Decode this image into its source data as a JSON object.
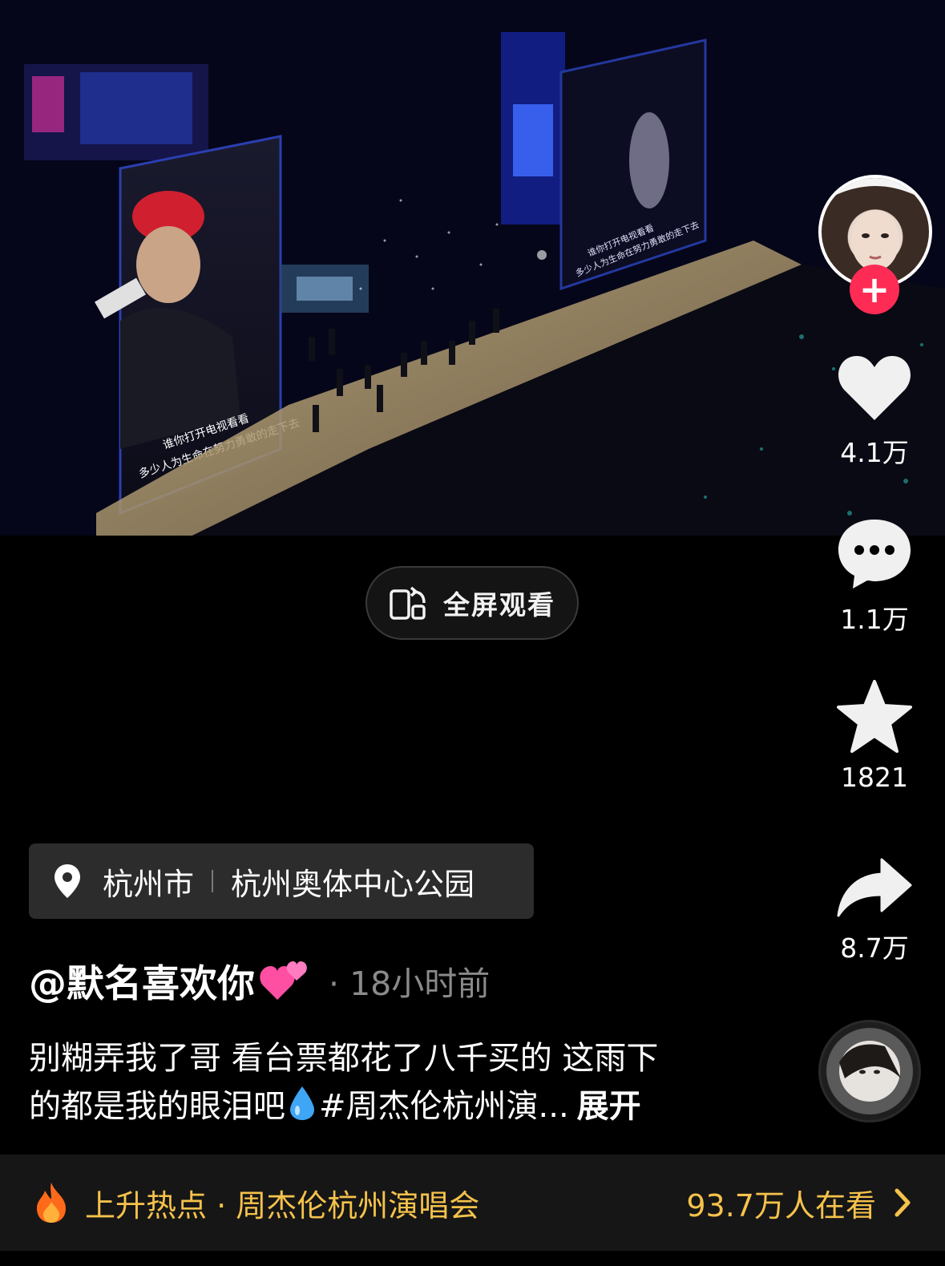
{
  "video": {
    "lyric_line_1": "谁你打开电视看看",
    "lyric_line_2": "多少人为生命在努力勇敢的走下去",
    "right_lyric_line_1": "谁你打开电视看看",
    "right_lyric_line_2": "多少人为生命在努力勇敢的走下去"
  },
  "fullscreen": {
    "label": "全屏观看",
    "icon": "rotate-screen-icon"
  },
  "actions": {
    "like_count": "4.1万",
    "comment_count": "1.1万",
    "favorite_count": "1821",
    "share_count": "8.7万"
  },
  "author_avatar": {
    "follow_icon": "plus-icon"
  },
  "location": {
    "city": "杭州市",
    "place": "杭州奥体中心公园"
  },
  "post": {
    "author": "@默名喜欢你",
    "meta": "· 18小时前",
    "caption_line_1": "别糊弄我了哥 看台票都花了八千买的 这雨下",
    "caption_line_2a": "的都是我的眼泪吧",
    "caption_line_2b": "#周杰伦杭州演...",
    "more": "展开"
  },
  "hot_bar": {
    "label": "上升热点 · 周杰伦杭州演唱会",
    "viewers": "93.7万人在看"
  },
  "colors": {
    "accent_red": "#fe2c55",
    "hot_yellow": "#f5c24b"
  }
}
